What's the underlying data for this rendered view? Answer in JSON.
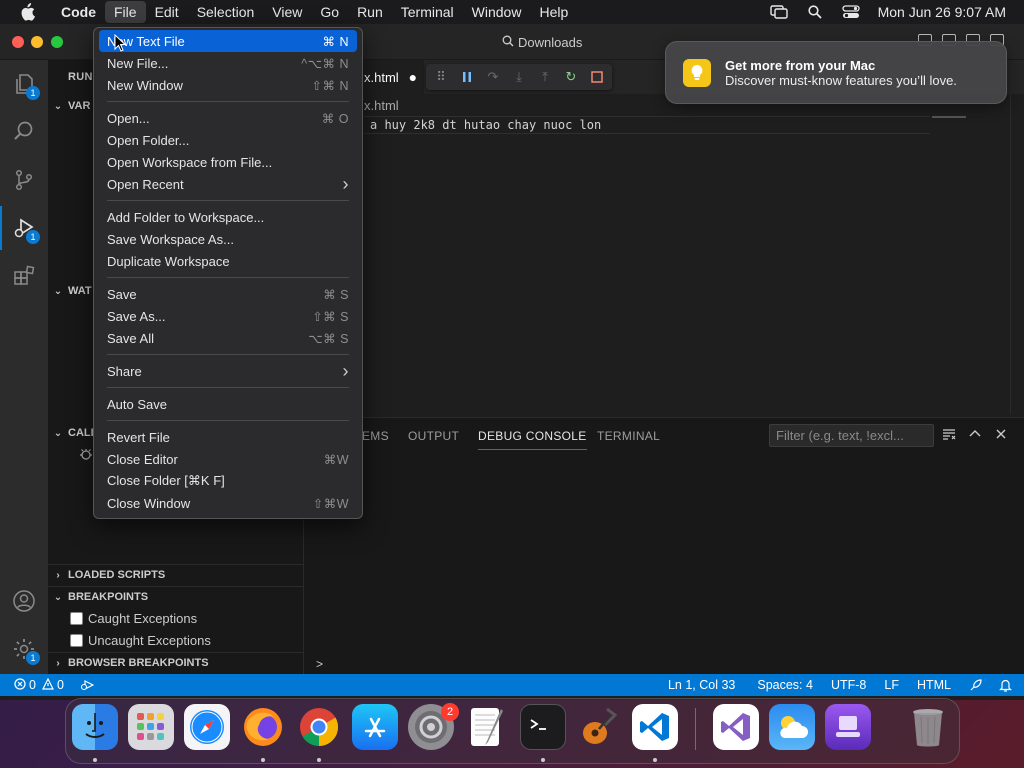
{
  "menubar": {
    "app": "Code",
    "items": [
      "File",
      "Edit",
      "Selection",
      "View",
      "Go",
      "Run",
      "Terminal",
      "Window",
      "Help"
    ],
    "clock": "Mon Jun 26  9:07 AM"
  },
  "titlebar": {
    "title": "Downloads"
  },
  "activity": {
    "explorer_badge": "1",
    "debug_badge": "1",
    "settings_badge": "1"
  },
  "sidebar": {
    "header": "RUN",
    "sections": {
      "variables": "VAR",
      "watch": "WAT",
      "callstack": "CALI",
      "loaded_scripts": "LOADED SCRIPTS",
      "breakpoints": "BREAKPOINTS",
      "browser_breakpoints": "BROWSER BREAKPOINTS"
    },
    "breakpoints": [
      {
        "label": "Caught Exceptions",
        "checked": false
      },
      {
        "label": "Uncaught Exceptions",
        "checked": false
      }
    ]
  },
  "editor": {
    "tab": "x.html",
    "breadcrumb": "x.html",
    "code_line": "a huy 2k8 dt hutao chay nuoc lon"
  },
  "panel": {
    "tabs": [
      "EMS",
      "OUTPUT",
      "DEBUG CONSOLE",
      "TERMINAL"
    ],
    "active_tab": "DEBUG CONSOLE",
    "filter_placeholder": "Filter (e.g. text, !excl...",
    "prompt": ">"
  },
  "status": {
    "errors": "0",
    "warnings": "0",
    "position": "Ln 1, Col 33",
    "spaces": "Spaces: 4",
    "encoding": "UTF-8",
    "eol": "LF",
    "language": "HTML"
  },
  "file_menu": {
    "items": [
      {
        "label": "New Text File",
        "shortcut": "⌘ N",
        "highlighted": true
      },
      {
        "label": "New File...",
        "shortcut": "^⌥⌘ N"
      },
      {
        "label": "New Window",
        "shortcut": "⇧⌘ N"
      },
      {
        "label": "Open...",
        "shortcut": "⌘ O"
      },
      {
        "label": "Open Folder...",
        "shortcut": ""
      },
      {
        "label": "Open Workspace from File...",
        "shortcut": ""
      },
      {
        "label": "Open Recent",
        "shortcut": "›"
      },
      {
        "label": "Add Folder to Workspace...",
        "shortcut": ""
      },
      {
        "label": "Save Workspace As...",
        "shortcut": ""
      },
      {
        "label": "Duplicate Workspace",
        "shortcut": ""
      },
      {
        "label": "Save",
        "shortcut": "⌘ S"
      },
      {
        "label": "Save As...",
        "shortcut": "⇧⌘ S"
      },
      {
        "label": "Save All",
        "shortcut": "⌥⌘ S"
      },
      {
        "label": "Share",
        "shortcut": "›"
      },
      {
        "label": "Auto Save",
        "shortcut": ""
      },
      {
        "label": "Revert File",
        "shortcut": ""
      },
      {
        "label": "Close Editor",
        "shortcut": "⌘W"
      },
      {
        "label": "Close Folder [⌘K F]",
        "shortcut": ""
      },
      {
        "label": "Close Window",
        "shortcut": "⇧⌘W"
      }
    ]
  },
  "notification": {
    "title": "Get more from your Mac",
    "body": "Discover must-know features you’ll love."
  },
  "dock": {
    "settings_badge": "2",
    "apps": [
      "finder-icon",
      "launchpad-icon",
      "safari-icon",
      "firefox-icon",
      "chrome-icon",
      "app-store-icon",
      "system-settings-icon",
      "textedit-icon",
      "terminal-icon",
      "garageband-icon",
      "vscode-icon",
      "visual-studio-icon",
      "weather-icon",
      "simulator-icon",
      "trash-icon"
    ]
  }
}
